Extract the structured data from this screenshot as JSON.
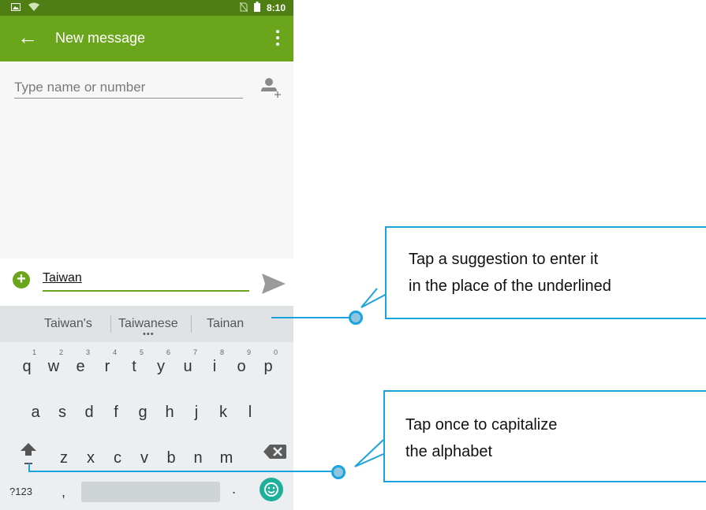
{
  "status_bar": {
    "time": "8:10"
  },
  "app_bar": {
    "title": "New message"
  },
  "recipients": {
    "placeholder": "Type name or number"
  },
  "compose": {
    "text": "Taiwan"
  },
  "keyboard": {
    "suggestions": [
      "Taiwan's",
      "Taiwanese",
      "Tainan"
    ],
    "row1": [
      {
        "key": "q",
        "hint": "1"
      },
      {
        "key": "w",
        "hint": "2"
      },
      {
        "key": "e",
        "hint": "3"
      },
      {
        "key": "r",
        "hint": "4"
      },
      {
        "key": "t",
        "hint": "5"
      },
      {
        "key": "y",
        "hint": "6"
      },
      {
        "key": "u",
        "hint": "7"
      },
      {
        "key": "i",
        "hint": "8"
      },
      {
        "key": "o",
        "hint": "9"
      },
      {
        "key": "p",
        "hint": "0"
      }
    ],
    "row2": [
      "a",
      "s",
      "d",
      "f",
      "g",
      "h",
      "j",
      "k",
      "l"
    ],
    "row3": [
      "z",
      "x",
      "c",
      "v",
      "b",
      "n",
      "m"
    ],
    "symbols_label": "?123",
    "comma": ",",
    "period": "."
  },
  "callouts": {
    "suggestion": {
      "line1": "Tap a suggestion to enter it",
      "line2": "in the place of the underlined"
    },
    "shift": {
      "line1": "Tap once to capitalize",
      "line2": "the alphabet"
    }
  },
  "colors": {
    "app_bar": "#6aa51b",
    "status_bar": "#4f7f14",
    "callout_border": "#1aa3dc",
    "emoji_key": "#1fb09c"
  }
}
